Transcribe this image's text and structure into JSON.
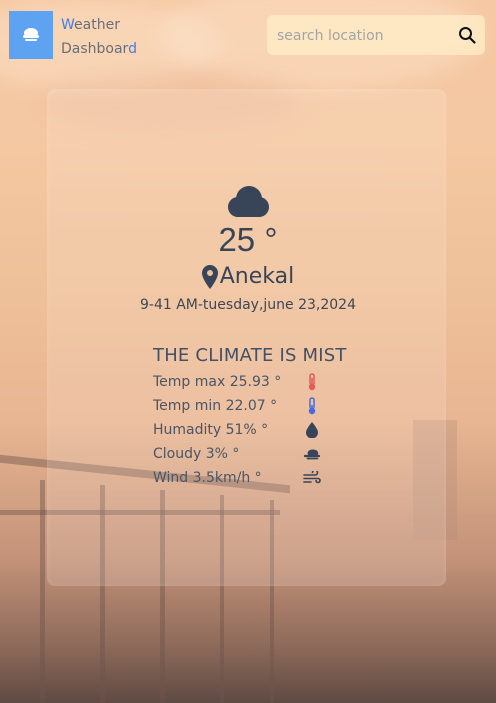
{
  "header": {
    "brand_line1_first": "W",
    "brand_line1_rest": "eather",
    "brand_line2_main": "Dashboar",
    "brand_line2_last": "d",
    "logo_icon": "cloud-icon"
  },
  "search": {
    "placeholder": "search location",
    "button_icon": "magnifier-icon"
  },
  "weather": {
    "temperature": "25 °",
    "location": "Anekal",
    "datetime": "9-41 AM-tuesday,june 23,2024",
    "climate": "THE CLIMATE IS MIST",
    "details": [
      {
        "label": "Temp max 25.93 °",
        "icon": "thermometer-hot-icon",
        "color": "#e85a5a"
      },
      {
        "label": "Temp min 22.07 °",
        "icon": "thermometer-cold-icon",
        "color": "#4a6be0"
      },
      {
        "label": "Humadity 51% °",
        "icon": "droplet-icon",
        "color": "#384458"
      },
      {
        "label": "Cloudy 3% °",
        "icon": "cloud-icon",
        "color": "#384458"
      },
      {
        "label": "Wind 3.5km/h °",
        "icon": "wind-icon",
        "color": "#384458"
      }
    ]
  },
  "colors": {
    "accent": "#5ea2f2",
    "text": "#384458"
  }
}
